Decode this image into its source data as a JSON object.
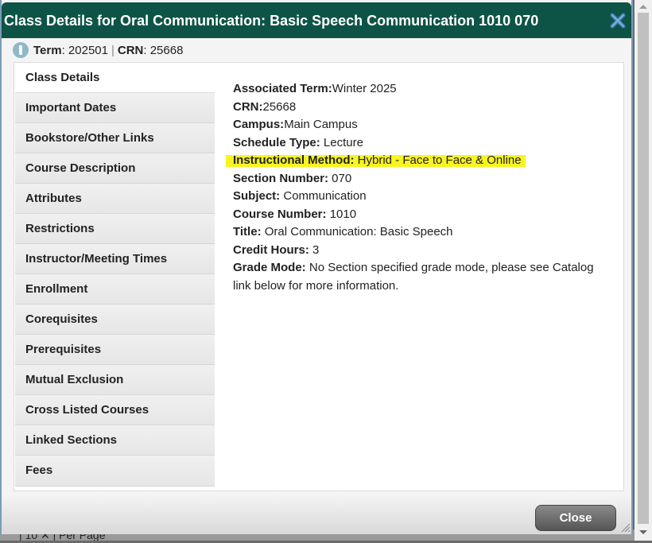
{
  "background": {
    "partial_text": "| 10 ✕ | Per Page"
  },
  "dialog": {
    "title": "Class Details for Oral Communication: Basic Speech Communication 1010 070",
    "close_icon": "close-x-icon",
    "accent_color": "#0d5447"
  },
  "infobar": {
    "icon": "info-icon",
    "term_label": "Term",
    "term_value": ": 202501",
    "separator": "|",
    "crn_label": "CRN",
    "crn_value": ": 25668"
  },
  "tabs": [
    {
      "label": "Class Details",
      "active": true
    },
    {
      "label": "Important Dates"
    },
    {
      "label": "Bookstore/Other Links"
    },
    {
      "label": "Course Description"
    },
    {
      "label": "Attributes"
    },
    {
      "label": "Restrictions"
    },
    {
      "label": "Instructor/Meeting Times"
    },
    {
      "label": "Enrollment"
    },
    {
      "label": "Corequisites"
    },
    {
      "label": "Prerequisites"
    },
    {
      "label": "Mutual Exclusion"
    },
    {
      "label": "Cross Listed Courses"
    },
    {
      "label": "Linked Sections"
    },
    {
      "label": "Fees"
    }
  ],
  "details": [
    {
      "label": "Associated Term:",
      "value": "Winter 2025"
    },
    {
      "label": "CRN:",
      "value": "25668"
    },
    {
      "label": "Campus:",
      "value": "Main Campus"
    },
    {
      "label": "Schedule Type:",
      "value": " Lecture"
    },
    {
      "label": "Instructional Method:",
      "value": " Hybrid - Face to Face & Online",
      "highlighted": true
    },
    {
      "label": "Section Number:",
      "value": " 070"
    },
    {
      "label": "Subject:",
      "value": " Communication"
    },
    {
      "label": "Course Number:",
      "value": " 1010"
    },
    {
      "label": "Title:",
      "value": " Oral Communication: Basic Speech"
    },
    {
      "label": "Credit Hours:",
      "value": " 3"
    },
    {
      "label": "Grade Mode:",
      "value": " No Section specified grade mode, please see Catalog link below for more information."
    }
  ],
  "highlight_color": "#f8f420",
  "footer": {
    "close_label": "Close"
  }
}
